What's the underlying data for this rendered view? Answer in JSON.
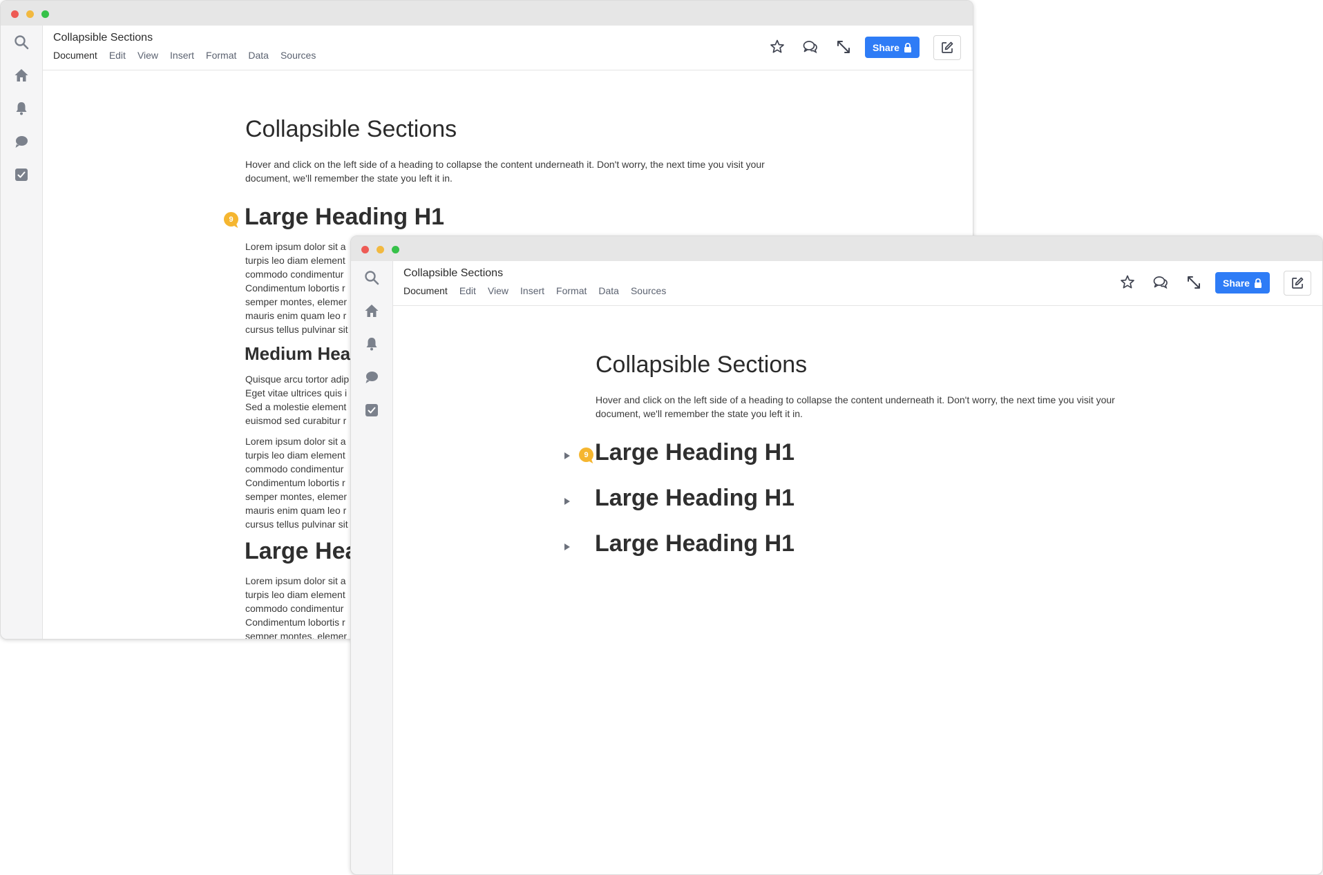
{
  "app": {
    "doc_title": "Collapsible Sections",
    "menu": [
      "Document",
      "Edit",
      "View",
      "Insert",
      "Format",
      "Data",
      "Sources"
    ],
    "share_label": "Share",
    "colors": {
      "accent": "#2e7cf6",
      "badge": "#f5b630",
      "sidebar": "#f5f5f6"
    },
    "sidebar_icons": [
      "search-icon",
      "home-icon",
      "bell-icon",
      "chat-icon",
      "checkbox-icon"
    ],
    "toolbar_icons": [
      "star-icon",
      "comments-icon",
      "expand-icon",
      "lock-icon",
      "edit-icon"
    ]
  },
  "page": {
    "title": "Collapsible Sections",
    "intro_line1": "Hover and click on the left side of a heading to collapse the content underneath it. Don't worry, the next time you visit your",
    "intro_line2": "document, we'll remember the state you left it in."
  },
  "back_window": {
    "badge_count": "9",
    "heading1": "Large Heading H1",
    "para1": [
      "Lorem ipsum dolor sit a",
      "turpis leo diam element",
      "commodo condimentur",
      "Condimentum lobortis r",
      "semper montes, elemer",
      "mauris enim quam leo r",
      "cursus tellus pulvinar sit"
    ],
    "heading2": "Medium Hea",
    "para2": [
      "Quisque arcu tortor adip",
      "Eget vitae ultrices quis i",
      "Sed a molestie element",
      "euismod sed curabitur r"
    ],
    "para3": [
      "Lorem ipsum dolor sit a",
      "turpis leo diam element",
      "commodo condimentur",
      "Condimentum lobortis r",
      "semper montes, elemer",
      "mauris enim quam leo r",
      "cursus tellus pulvinar sit"
    ],
    "heading3": "Large Hea",
    "para4": [
      "Lorem ipsum dolor sit a",
      "turpis leo diam element",
      "commodo condimentur",
      "Condimentum lobortis r",
      "semper montes, elemer"
    ]
  },
  "front_window": {
    "badge_count": "9",
    "sections": [
      {
        "heading": "Large Heading H1"
      },
      {
        "heading": "Large Heading H1"
      },
      {
        "heading": "Large Heading H1"
      }
    ]
  }
}
